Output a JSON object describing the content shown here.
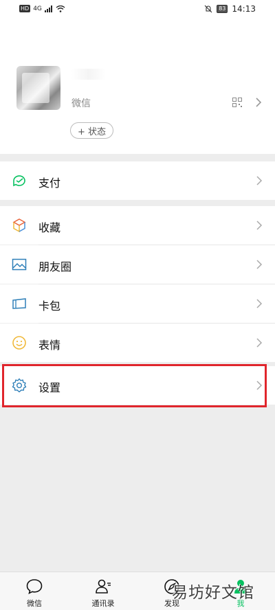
{
  "status_bar": {
    "left_badge": "HD",
    "network": "4G",
    "battery": "83",
    "time": "14:13"
  },
  "profile": {
    "wechat_id_label": "微信",
    "status_button": "+ 状态"
  },
  "menu": {
    "pay": "支付",
    "favorites": "收藏",
    "moments": "朋友圈",
    "cards": "卡包",
    "stickers": "表情",
    "settings": "设置"
  },
  "tabbar": {
    "chats": "微信",
    "contacts": "通讯录",
    "discover": "发现",
    "me": "我"
  },
  "watermark": "易坊好文馆",
  "colors": {
    "accent": "#07c160",
    "highlight": "#e0252c",
    "icon_blue": "#2e7fb8"
  }
}
